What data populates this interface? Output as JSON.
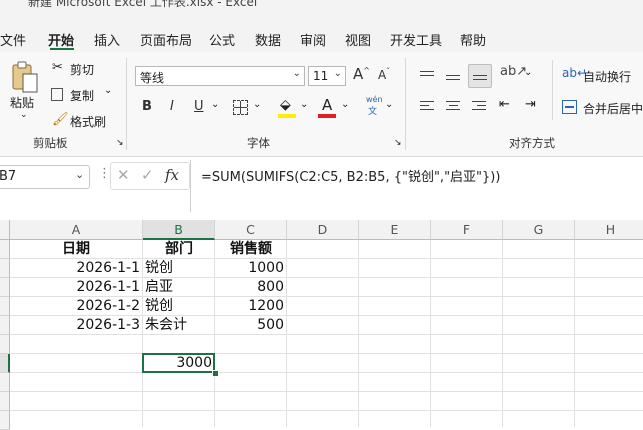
{
  "window": {
    "title": "新建 Microsoft Excel 工作表.xlsx  -  Excel"
  },
  "menu": {
    "items": [
      "文件",
      "开始",
      "插入",
      "页面布局",
      "公式",
      "数据",
      "审阅",
      "视图",
      "开发工具",
      "帮助"
    ],
    "active": "开始"
  },
  "clipboard": {
    "paste": "粘贴",
    "cut": "剪切",
    "copy": "复制",
    "format_painter": "格式刷",
    "group_label": "剪贴板"
  },
  "font": {
    "family": "等线",
    "size": "11",
    "group_label": "字体",
    "grow": "A",
    "shrink": "A",
    "bold": "B",
    "italic": "I",
    "underline": "U",
    "font_color_letter": "A",
    "phonetic_top": "wén",
    "phonetic_bottom": "文",
    "highlight_color": "#ffee00",
    "font_color": "#e02020"
  },
  "alignment": {
    "wrap": "自动换行",
    "merge": "合并后居中",
    "group_label": "对齐方式"
  },
  "formula_bar": {
    "name_box": "B7",
    "cancel_icon": "x-icon",
    "enter_icon": "check-icon",
    "fx": "fx",
    "formula": "=SUM(SUMIFS(C2:C5, B2:B5, {\"锐创\",\"启亚\"}))"
  },
  "sheet": {
    "columns": [
      "A",
      "B",
      "C",
      "D",
      "E",
      "F",
      "G",
      "H"
    ],
    "selected_column": "B",
    "headers": [
      "日期",
      "部门",
      "销售额"
    ],
    "rows": [
      {
        "date": "2026-1-1",
        "dept": "锐创",
        "sales": "1000"
      },
      {
        "date": "2026-1-1",
        "dept": "启亚",
        "sales": "800"
      },
      {
        "date": "2026-1-2",
        "dept": "锐创",
        "sales": "1200"
      },
      {
        "date": "2026-1-3",
        "dept": "朱会计",
        "sales": "500"
      }
    ],
    "result_cell_value": "3000",
    "accent_color": "#1e7145"
  }
}
